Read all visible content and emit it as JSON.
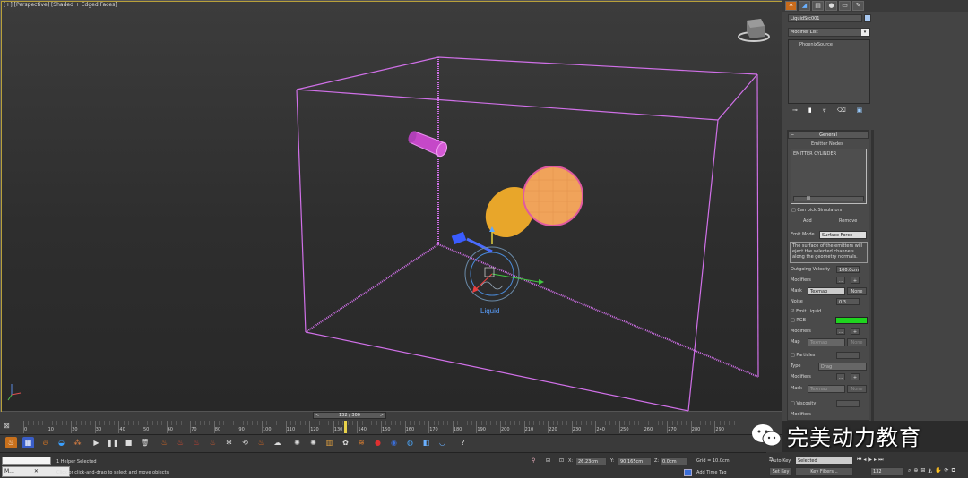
{
  "viewport": {
    "label": "[+] [Perspective] [Shaded + Edged Faces]",
    "object_label": "Liquid"
  },
  "command_panel": {
    "object_name": "LiquidSrc001",
    "modifier_list": "Modifier List",
    "stack_item": "PhoenixSource",
    "general": {
      "header": "General",
      "emitter_nodes_label": "Emitter Nodes",
      "emitter_item": "EMITTER CYLINDER",
      "scroll_mid": "III",
      "can_pick_simulators": "Can pick Simulators",
      "add_label": "Add",
      "remove_label": "Remove",
      "emit_mode_label": "Emit Mode",
      "emit_mode_value": "Surface Force",
      "description": "The surface of the emitters will eject the selected channels along the geometry normals.",
      "outgoing_velocity_label": "Outgoing Velocity",
      "outgoing_velocity_value": "100.0cm",
      "modifiers_label": "Modifiers",
      "mod_btn_dots": "...",
      "mod_btn_plus": "+",
      "mask_label": "Mask",
      "mask_value": "Texmap",
      "mask_none": "None",
      "noise_label": "Noise",
      "noise_value": "0.3",
      "emit_liquid_label": "Emit Liquid",
      "rgb_label": "RGB",
      "rgb_color": "#1fd41f",
      "map_label": "Map",
      "map_value": "Texmap",
      "map_none": "None",
      "particles_label": "Particles",
      "type_label": "Type",
      "type_value": "Drag",
      "velocity_label": "Viscosity"
    }
  },
  "timeline": {
    "frame_indicator": "132 / 300",
    "nav_prev": "<",
    "nav_next": ">",
    "ticks": [
      "0",
      "10",
      "20",
      "30",
      "40",
      "50",
      "60",
      "70",
      "80",
      "90",
      "100",
      "110",
      "120",
      "130",
      "140",
      "150",
      "160",
      "170",
      "180",
      "190",
      "200",
      "210",
      "220",
      "230",
      "240",
      "250",
      "260",
      "270",
      "280",
      "290"
    ]
  },
  "status": {
    "selection": "1 Helper Selected",
    "prompt": "Click or click-and-drag to select and move objects",
    "taskbar_item": "M...",
    "x_label": "X:",
    "x_value": "26.23cm",
    "y_label": "Y:",
    "y_value": "90.165cm",
    "z_label": "Z:",
    "z_value": "0.0cm",
    "grid": "Grid = 10.0cm",
    "add_time_tag": "Add Time Tag",
    "auto_key": "Auto Key",
    "selected": "Selected",
    "set_key": "Set Key",
    "key_filters": "Key Filters...",
    "frame_value": "132",
    "watermark": "完美动力教育"
  }
}
